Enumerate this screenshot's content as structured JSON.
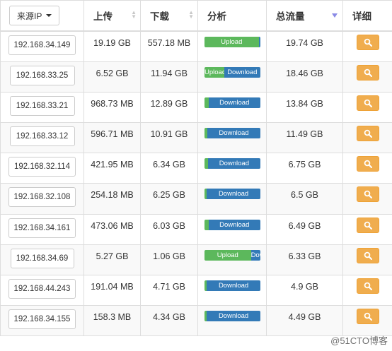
{
  "header": {
    "source_ip_label": "来源IP",
    "upload": "上传",
    "download": "下载",
    "analysis": "分析",
    "total": "总流量",
    "detail": "详细"
  },
  "rows": [
    {
      "ip": "192.168.34.149",
      "up": "19.19 GB",
      "down": "557.18 MB",
      "total": "19.74 GB",
      "up_pct": 97,
      "up_label": "Upload",
      "down_label": ""
    },
    {
      "ip": "192.168.33.25",
      "up": "6.52 GB",
      "down": "11.94 GB",
      "total": "18.46 GB",
      "up_pct": 35,
      "up_label": "Upload",
      "down_label": "Download"
    },
    {
      "ip": "192.168.33.21",
      "up": "968.73 MB",
      "down": "12.89 GB",
      "total": "13.84 GB",
      "up_pct": 7,
      "up_label": "",
      "down_label": "Download"
    },
    {
      "ip": "192.168.33.12",
      "up": "596.71 MB",
      "down": "10.91 GB",
      "total": "11.49 GB",
      "up_pct": 5,
      "up_label": "",
      "down_label": "Download"
    },
    {
      "ip": "192.168.32.114",
      "up": "421.95 MB",
      "down": "6.34 GB",
      "total": "6.75 GB",
      "up_pct": 6,
      "up_label": "",
      "down_label": "Download"
    },
    {
      "ip": "192.168.32.108",
      "up": "254.18 MB",
      "down": "6.25 GB",
      "total": "6.5 GB",
      "up_pct": 4,
      "up_label": "",
      "down_label": "Download"
    },
    {
      "ip": "192.168.34.161",
      "up": "473.06 MB",
      "down": "6.03 GB",
      "total": "6.49 GB",
      "up_pct": 7,
      "up_label": "",
      "down_label": "Download"
    },
    {
      "ip": "192.168.34.69",
      "up": "5.27 GB",
      "down": "1.06 GB",
      "total": "6.33 GB",
      "up_pct": 83,
      "up_label": "Upload",
      "down_label": "Download"
    },
    {
      "ip": "192.168.44.243",
      "up": "191.04 MB",
      "down": "4.71 GB",
      "total": "4.9 GB",
      "up_pct": 4,
      "up_label": "",
      "down_label": "Download"
    },
    {
      "ip": "192.168.34.155",
      "up": "158.3 MB",
      "down": "4.34 GB",
      "total": "4.49 GB",
      "up_pct": 4,
      "up_label": "",
      "down_label": "Download"
    }
  ],
  "icons": {
    "search": "search-icon",
    "caret": "caret-down-icon"
  },
  "colors": {
    "upload": "#5cb85c",
    "download": "#337ab7",
    "detail_button": "#f0ad4e"
  },
  "watermark": "@51CTO博客"
}
